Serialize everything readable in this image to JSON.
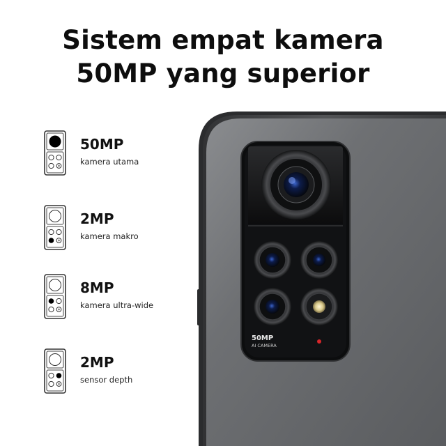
{
  "headline": {
    "line1": "Sistem empat kamera",
    "line2": "50MP yang superior"
  },
  "specs": [
    {
      "resolution": "50MP",
      "label": "kamera utama",
      "highlight": "main"
    },
    {
      "resolution": "2MP",
      "label": "kamera makro",
      "highlight": "macro"
    },
    {
      "resolution": "8MP",
      "label": "kamera ultra-wide",
      "highlight": "ultrawide"
    },
    {
      "resolution": "2MP",
      "label": "sensor depth",
      "highlight": "depth"
    }
  ],
  "phone": {
    "module_text_1": "50MP",
    "module_text_2": "AI CAMERA",
    "body_color": "#6b6d70",
    "module_color": "#111214",
    "flash_color": "#d9c98a",
    "indicator_color": "#d8262a"
  }
}
